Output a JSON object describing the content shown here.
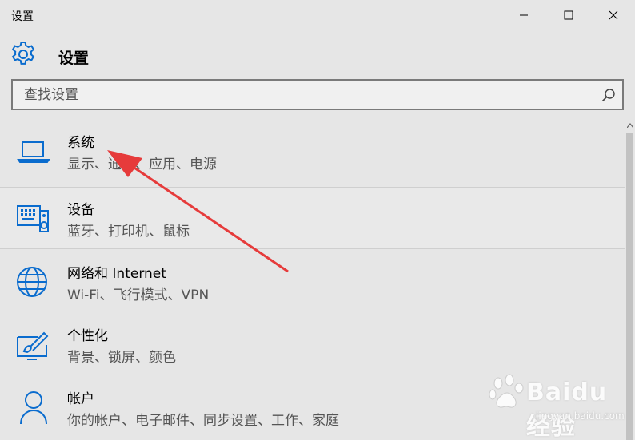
{
  "window": {
    "title": "设置",
    "minimize_icon": "minimize-icon",
    "maximize_icon": "maximize-icon",
    "close_icon": "close-icon"
  },
  "header": {
    "title": "设置",
    "icon": "gear-icon"
  },
  "search": {
    "placeholder": "查找设置",
    "value": "",
    "icon": "search-icon"
  },
  "items": [
    {
      "title": "系统",
      "subtitle": "显示、通知、应用、电源",
      "icon": "laptop-icon"
    },
    {
      "title": "设备",
      "subtitle": "蓝牙、打印机、鼠标",
      "icon": "devices-icon"
    },
    {
      "title": "网络和 Internet",
      "subtitle": "Wi-Fi、飞行模式、VPN",
      "icon": "globe-icon"
    },
    {
      "title": "个性化",
      "subtitle": "背景、锁屏、颜色",
      "icon": "personalization-icon"
    },
    {
      "title": "帐户",
      "subtitle": "你的帐户、电子邮件、同步设置、工作、家庭",
      "icon": "person-icon"
    }
  ],
  "selected_index": 1,
  "annotation": {
    "type": "red-arrow",
    "color": "#e63b3b",
    "points_to": "系统"
  },
  "watermark": {
    "text": "Baidu经验",
    "url": "jingyan.baidu.com"
  },
  "colors": {
    "accent": "#0a6cce",
    "background": "#e6e6e6",
    "arrow": "#e63b3b"
  }
}
